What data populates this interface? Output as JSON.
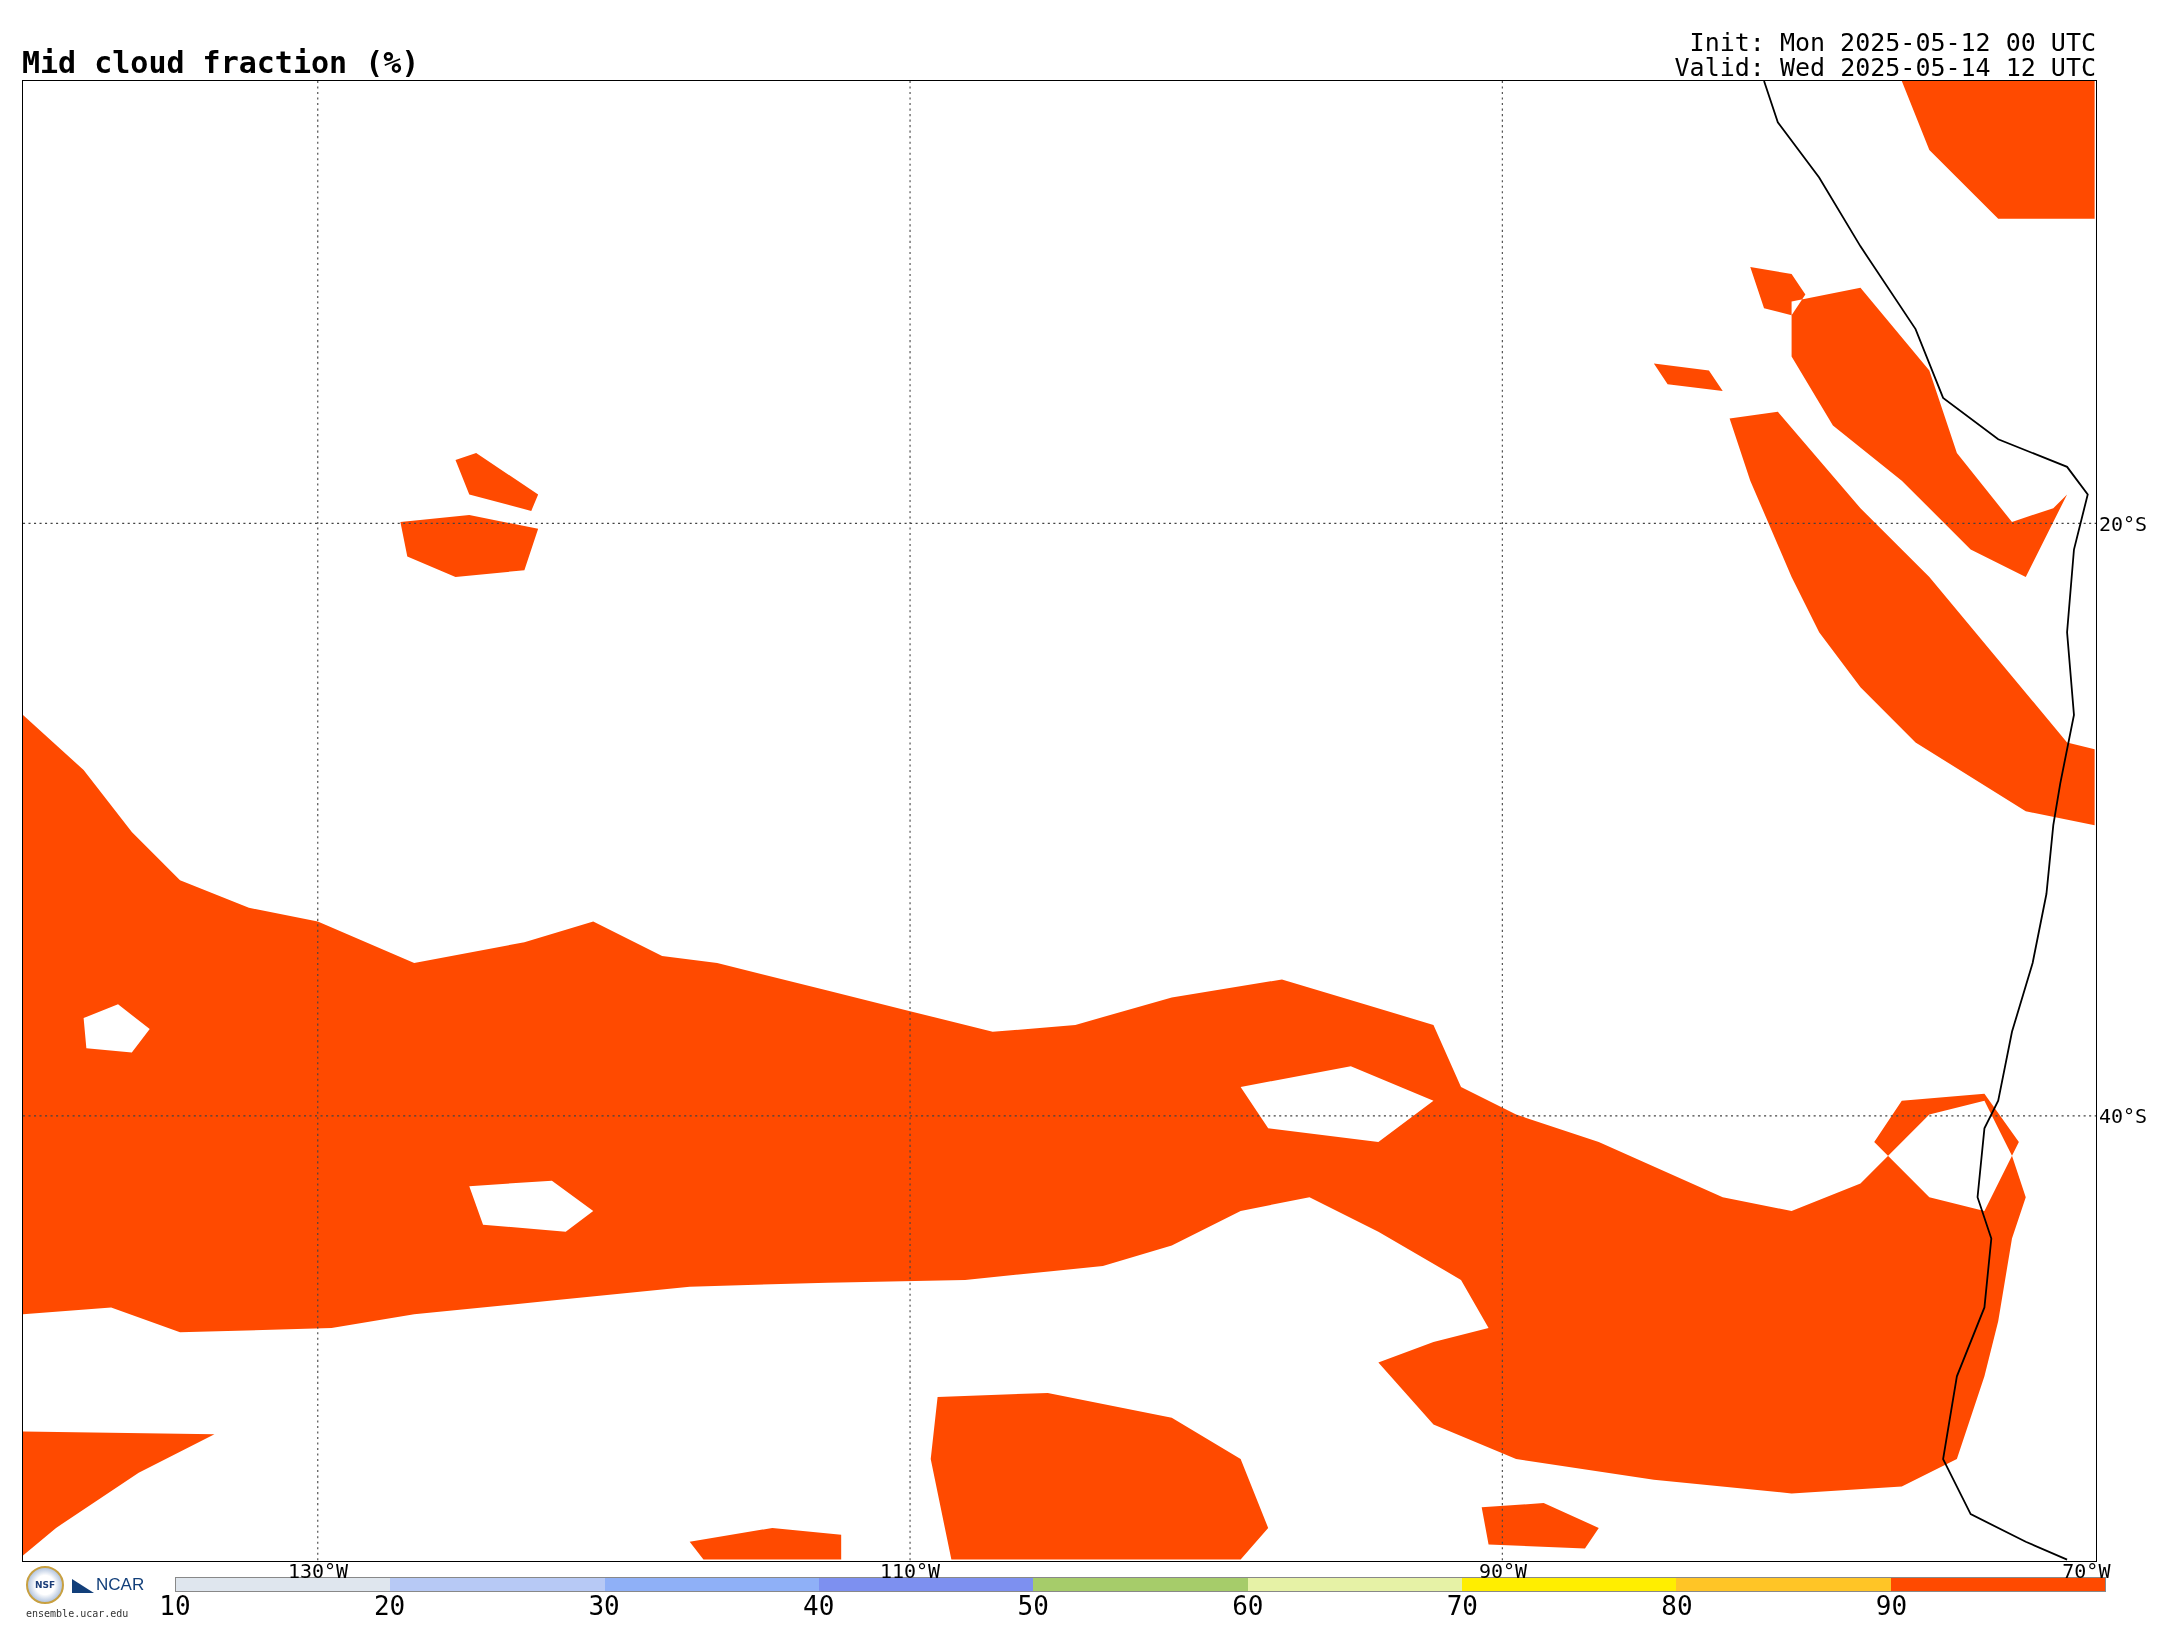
{
  "header": {
    "title": "Mid cloud fraction (%)",
    "init": "Init: Mon 2025-05-12 00 UTC",
    "valid": "Valid: Wed 2025-05-14 12 UTC"
  },
  "map": {
    "lat_labels": [
      "20°S",
      "40°S"
    ],
    "lon_labels": [
      "130°W",
      "110°W",
      "90°W",
      "70°W"
    ]
  },
  "logo": {
    "seal": "NSF",
    "name": "NCAR",
    "url": "ensemble.ucar.edu"
  },
  "colorbar": {
    "segments": [
      {
        "label": "10",
        "color": "#dfe6ee"
      },
      {
        "label": "20",
        "color": "#b7c9f5"
      },
      {
        "label": "30",
        "color": "#8fb0f7"
      },
      {
        "label": "40",
        "color": "#7d90f0"
      },
      {
        "label": "50",
        "color": "#a6cc6a"
      },
      {
        "label": "60",
        "color": "#e6f2a6"
      },
      {
        "label": "70",
        "color": "#ffee00"
      },
      {
        "label": "80",
        "color": "#ffc526"
      },
      {
        "label": "90",
        "color": "#ff4a00"
      }
    ]
  }
}
